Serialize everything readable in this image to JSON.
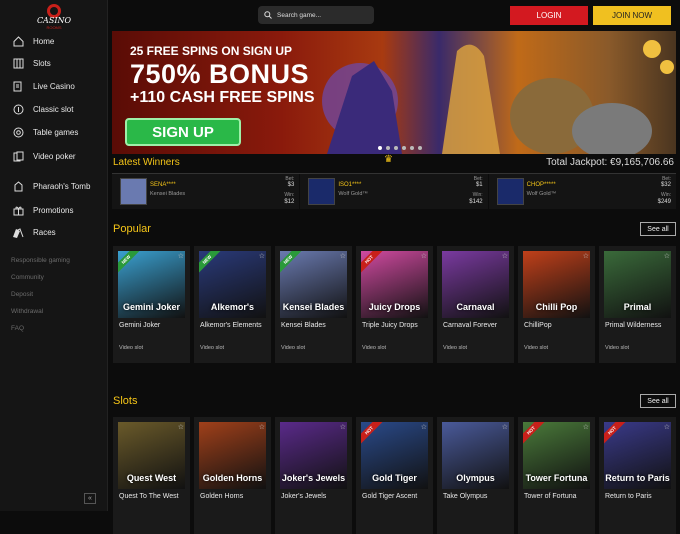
{
  "brand": {
    "logo_text": "CASINO",
    "logo_sub": "ROOMS"
  },
  "search": {
    "placeholder": "Search game..."
  },
  "header": {
    "login_label": "LOGIN",
    "join_label": "JOIN NOW"
  },
  "sidebar": {
    "items": [
      {
        "label": "Home",
        "icon": "home-icon"
      },
      {
        "label": "Slots",
        "icon": "slots-icon"
      },
      {
        "label": "Live Casino",
        "icon": "live-casino-icon"
      },
      {
        "label": "Classic slot",
        "icon": "classic-slot-icon"
      },
      {
        "label": "Table games",
        "icon": "table-games-icon"
      },
      {
        "label": "Video poker",
        "icon": "video-poker-icon"
      },
      {
        "label": "Pharaoh's Tomb",
        "icon": "pharaoh-icon"
      },
      {
        "label": "Promotions",
        "icon": "gift-icon"
      },
      {
        "label": "Races",
        "icon": "race-flags-icon"
      }
    ],
    "links": [
      "Responsible gaming",
      "Community",
      "Deposit",
      "Withdrawal",
      "FAQ"
    ],
    "collapse_label": "«"
  },
  "banner": {
    "line1": "25 FREE SPINS ON SIGN UP",
    "line2": "750% BONUS",
    "line3": "+110 CASH FREE SPINS",
    "cta": "SIGN UP",
    "slide_count": 6,
    "active_slide": 0
  },
  "winners": {
    "title": "Latest Winners",
    "jackpot": "Total Jackpot: €9,165,706.66",
    "bet_label": "Bet:",
    "win_label": "Win:",
    "items": [
      {
        "name": "SENA****",
        "game": "Kensei Blades",
        "bet": "$3",
        "win": "$12"
      },
      {
        "name": "ISO1****",
        "game": "Wolf Gold™",
        "bet": "$1",
        "win": "$142"
      },
      {
        "name": "CHOP*****",
        "game": "Wolf Gold™",
        "bet": "$32",
        "win": "$249"
      }
    ]
  },
  "popular": {
    "title": "Popular",
    "see_all": "See all",
    "games": [
      {
        "title": "Gemini Joker",
        "type": "Video slot",
        "art": "Gemini Joker",
        "ribbon": "NEW",
        "ribbon_color": "#2a9a3a",
        "color": "#3aa0d0"
      },
      {
        "title": "Alkemor's Elements",
        "type": "Video slot",
        "art": "Alkemor's",
        "ribbon": "NEW",
        "ribbon_color": "#2a9a3a",
        "color": "#2a3a7a"
      },
      {
        "title": "Kensei Blades",
        "type": "Video slot",
        "art": "Kensei Blades",
        "ribbon": "NEW",
        "ribbon_color": "#2a9a3a",
        "color": "#6a7ab0"
      },
      {
        "title": "Triple Juicy Drops",
        "type": "Video slot",
        "art": "Juicy Drops",
        "ribbon": "HOT",
        "ribbon_color": "#c8201a",
        "color": "#d04aa0"
      },
      {
        "title": "Carnaval Forever",
        "type": "Video slot",
        "art": "Carnaval",
        "ribbon": "",
        "ribbon_color": "",
        "color": "#7a3aa0"
      },
      {
        "title": "ChilliPop",
        "type": "Video slot",
        "art": "Chilli Pop",
        "ribbon": "",
        "ribbon_color": "",
        "color": "#c0401a"
      },
      {
        "title": "Primal Wilderness",
        "type": "Video slot",
        "art": "Primal",
        "ribbon": "",
        "ribbon_color": "",
        "color": "#3a6a3a"
      }
    ]
  },
  "slots": {
    "title": "Slots",
    "see_all": "See all",
    "games": [
      {
        "title": "Quest To The West",
        "art": "Quest West",
        "ribbon": "",
        "ribbon_color": "",
        "color": "#6a5a2a"
      },
      {
        "title": "Golden Horns",
        "art": "Golden Horns",
        "ribbon": "",
        "ribbon_color": "",
        "color": "#a0401a"
      },
      {
        "title": "Joker's Jewels",
        "art": "Joker's Jewels",
        "ribbon": "",
        "ribbon_color": "",
        "color": "#5a2a8a"
      },
      {
        "title": "Gold Tiger Ascent",
        "art": "Gold Tiger",
        "ribbon": "HOT",
        "ribbon_color": "#c8201a",
        "color": "#2a4a8a"
      },
      {
        "title": "Take Olympus",
        "art": "Olympus",
        "ribbon": "",
        "ribbon_color": "",
        "color": "#4a5a9a"
      },
      {
        "title": "Tower of Fortuna",
        "art": "Tower Fortuna",
        "ribbon": "HOT",
        "ribbon_color": "#c8201a",
        "color": "#4a7a3a"
      },
      {
        "title": "Return to Paris",
        "art": "Return to Paris",
        "ribbon": "HOT",
        "ribbon_color": "#c8201a",
        "color": "#3a3a8a"
      }
    ]
  },
  "colors": {
    "accent": "#f5c518",
    "login": "#d31920",
    "join": "#f0c020",
    "signup": "#2ab848"
  }
}
